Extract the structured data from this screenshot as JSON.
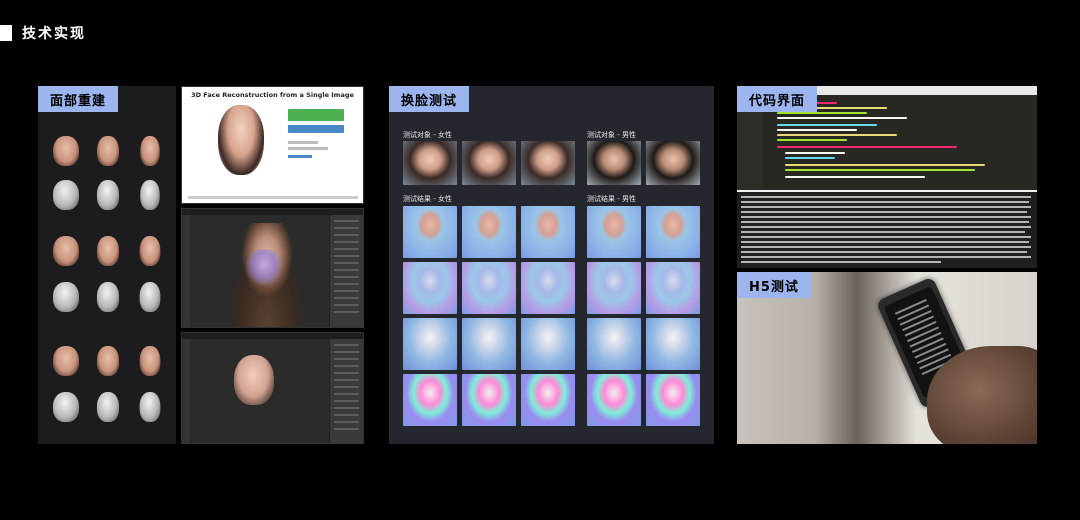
{
  "page": {
    "title": "技术实现"
  },
  "panels": {
    "reconstruction": {
      "tag": "面部重建"
    },
    "web_demo": {
      "title": "3D Face Reconstruction from a Single Image"
    },
    "face_swap": {
      "tag": "换脸测试",
      "female_subjects": "测试对象 - 女性",
      "male_subjects": "测试对象 - 男性",
      "female_results": "测试结果 - 女性",
      "male_results": "测试结果 - 男性"
    },
    "code": {
      "tag": "代码界面"
    },
    "h5": {
      "tag": "H5测试"
    }
  },
  "colors": {
    "background": "#000000",
    "tag_bg": "#9cb5ee",
    "panel_dark": "#1c1c1e",
    "panel_swap": "#24272d",
    "editor_bg": "#272822"
  }
}
